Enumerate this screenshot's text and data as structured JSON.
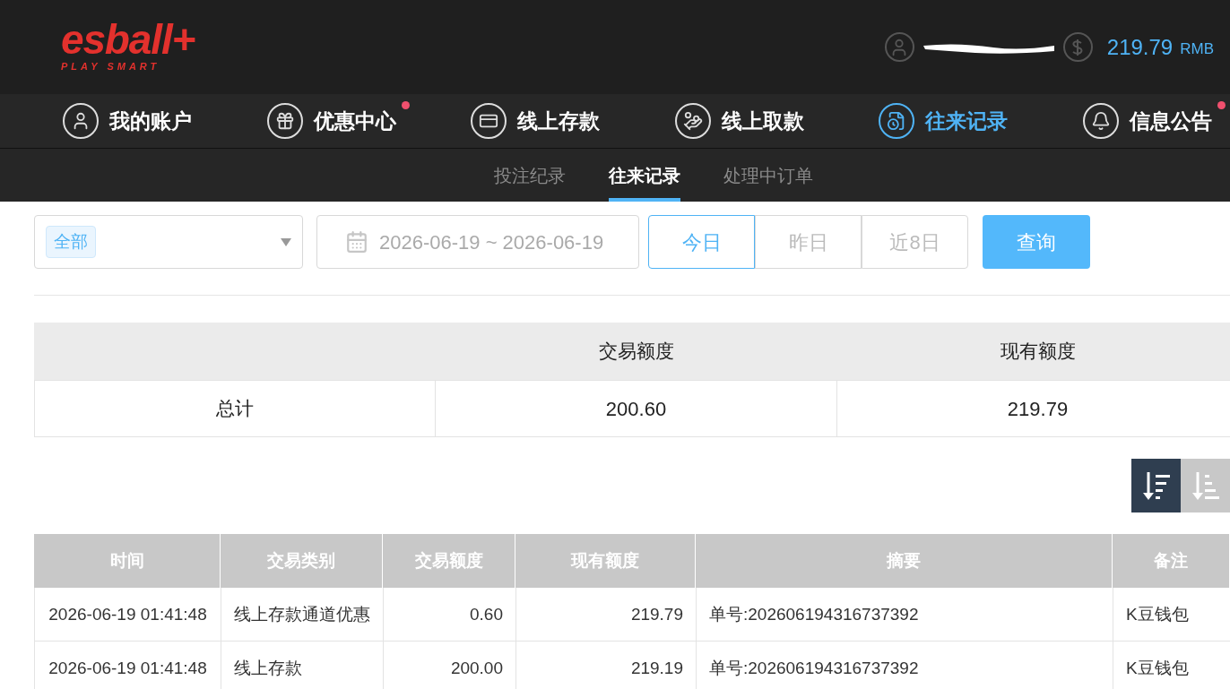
{
  "logo": {
    "brand": "esball+",
    "tagline": "PLAY SMART"
  },
  "account": {
    "balance": "219.79",
    "currency": "RMB"
  },
  "nav": [
    {
      "kind": "user",
      "label": "我的账户",
      "selected": false,
      "notification": false
    },
    {
      "kind": "gift",
      "label": "优惠中心",
      "selected": false,
      "notification": true
    },
    {
      "kind": "deposit",
      "label": "线上存款",
      "selected": false,
      "notification": false
    },
    {
      "kind": "withdraw",
      "label": "线上取款",
      "selected": false,
      "notification": false
    },
    {
      "kind": "records",
      "label": "往来记录",
      "selected": true,
      "notification": false
    },
    {
      "kind": "bell",
      "label": "信息公告",
      "selected": false,
      "notification": true
    }
  ],
  "subtabs": [
    {
      "label": "投注纪录",
      "selected": false
    },
    {
      "label": "往来记录",
      "selected": true
    },
    {
      "label": "处理中订单",
      "selected": false
    }
  ],
  "filter": {
    "type_tag": "全部",
    "date_range": "2026-06-19 ~ 2026-06-19",
    "quick_ranges": [
      {
        "label": "今日",
        "selected": true
      },
      {
        "label": "昨日",
        "selected": false
      },
      {
        "label": "近8日",
        "selected": false
      }
    ],
    "search_button": "查询"
  },
  "summary": {
    "columns": [
      "交易额度",
      "现有额度"
    ],
    "row": {
      "label": "总计",
      "values": [
        "200.60",
        "219.79"
      ]
    }
  },
  "sort_buttons": [
    {
      "kind": "descending",
      "selected": true
    },
    {
      "kind": "ascending",
      "selected": false
    }
  ],
  "table": {
    "columns": [
      "时间",
      "交易类别",
      "交易额度",
      "现有额度",
      "摘要",
      "备注"
    ],
    "rows": [
      [
        "2026-06-19 01:41:48",
        "线上存款通道优惠",
        "0.60",
        "219.79",
        "单号:202606194316737392",
        "K豆钱包"
      ],
      [
        "2026-06-19 01:41:48",
        "线上存款",
        "200.00",
        "219.19",
        "单号:202606194316737392",
        "K豆钱包"
      ]
    ]
  }
}
